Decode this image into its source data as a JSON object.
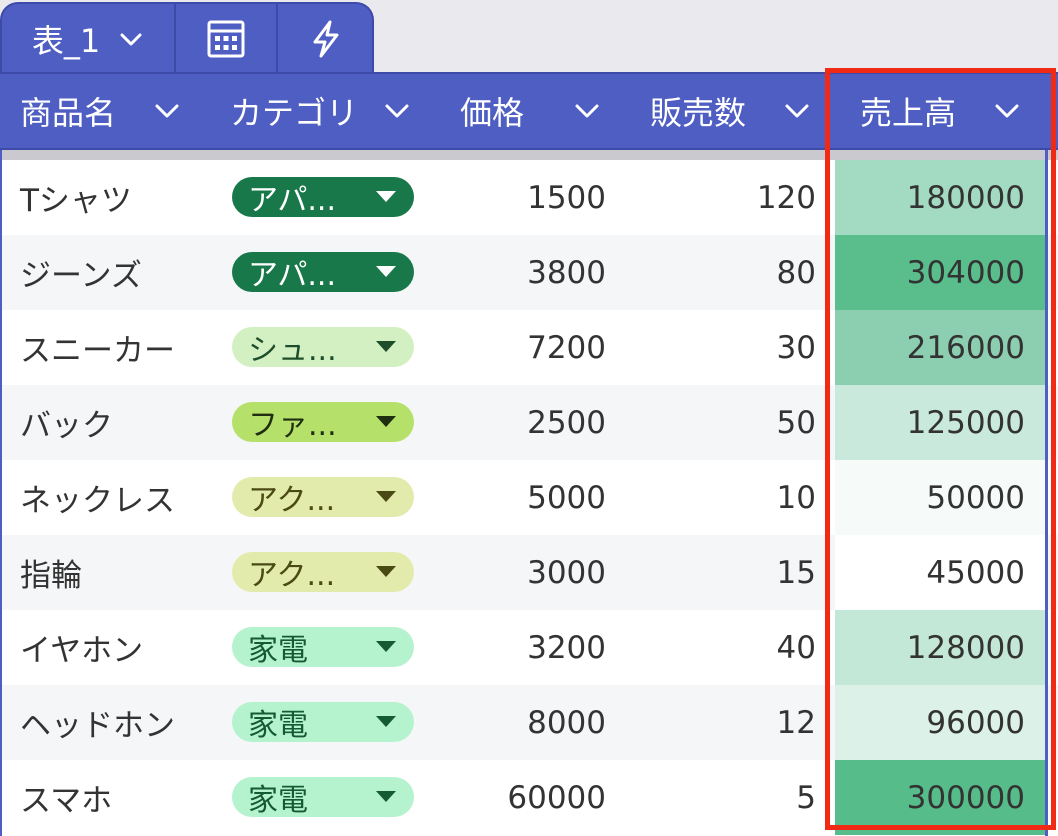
{
  "tab": {
    "name": "表_1",
    "icons": [
      "calculator-icon",
      "lightning-icon"
    ]
  },
  "columns": [
    {
      "key": "name",
      "label": "商品名"
    },
    {
      "key": "category",
      "label": "カテゴリ"
    },
    {
      "key": "price",
      "label": "価格"
    },
    {
      "key": "qty",
      "label": "販売数"
    },
    {
      "key": "sales",
      "label": "売上高"
    }
  ],
  "rows": [
    {
      "name": "Tシャツ",
      "category": "アパ...",
      "price": "1500",
      "qty": "120",
      "sales": "180000"
    },
    {
      "name": "ジーンズ",
      "category": "アパ...",
      "price": "3800",
      "qty": "80",
      "sales": "304000"
    },
    {
      "name": "スニーカー",
      "category": "シュ...",
      "price": "7200",
      "qty": "30",
      "sales": "216000"
    },
    {
      "name": "バック",
      "category": "ファ...",
      "price": "2500",
      "qty": "50",
      "sales": "125000"
    },
    {
      "name": "ネックレス",
      "category": "アク...",
      "price": "5000",
      "qty": "10",
      "sales": "50000"
    },
    {
      "name": "指輪",
      "category": "アク...",
      "price": "3000",
      "qty": "15",
      "sales": "45000"
    },
    {
      "name": "イヤホン",
      "category": "家電",
      "price": "3200",
      "qty": "40",
      "sales": "128000"
    },
    {
      "name": "ヘッドホン",
      "category": "家電",
      "price": "8000",
      "qty": "12",
      "sales": "96000"
    },
    {
      "name": "スマホ",
      "category": "家電",
      "price": "60000",
      "qty": "5",
      "sales": "300000"
    }
  ],
  "chip_styles": [
    {
      "bg": "#18784a",
      "fg": "#ffffff"
    },
    {
      "bg": "#18784a",
      "fg": "#ffffff"
    },
    {
      "bg": "#d3f0c2",
      "fg": "#1e4d2b"
    },
    {
      "bg": "#b5e06a",
      "fg": "#1f2d10"
    },
    {
      "bg": "#e3ebac",
      "fg": "#4a4a14"
    },
    {
      "bg": "#e3ebac",
      "fg": "#4a4a14"
    },
    {
      "bg": "#b5f3cf",
      "fg": "#145a32"
    },
    {
      "bg": "#b5f3cf",
      "fg": "#145a32"
    },
    {
      "bg": "#b5f3cf",
      "fg": "#145a32"
    }
  ],
  "sales_colors": [
    "#a3dbc2",
    "#59be8c",
    "#8ccfb0",
    "#c8e9dc",
    "#f6fbf9",
    "#ffffff",
    "#c4e8d8",
    "#dcf1e7",
    "#56bd8a"
  ],
  "colors": {
    "header_bg": "#4f5ec2",
    "highlight_border": "#f02a14"
  }
}
